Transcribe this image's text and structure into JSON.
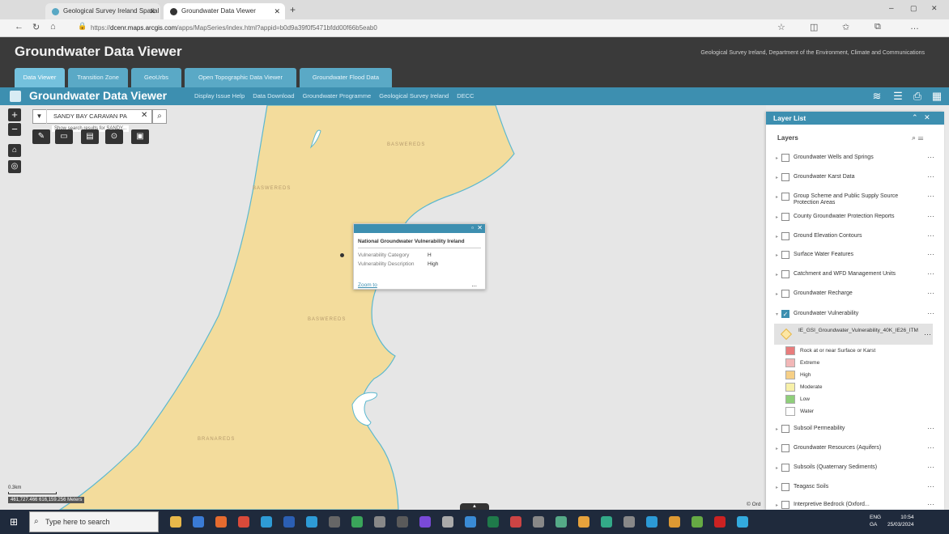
{
  "browser": {
    "tabs": [
      {
        "label": "Geological Survey Ireland Spatial",
        "active": false
      },
      {
        "label": "Groundwater Data Viewer",
        "active": true
      }
    ],
    "url_host": "dcenr.maps.arcgis.com",
    "url_path": "/apps/MapSeries/index.html?appid=b0d9a39f0f5471bfdd00f66b5eab0"
  },
  "app": {
    "title": "Groundwater Data Viewer",
    "department": "Geological Survey Ireland, Department of the Environment, Climate and Communications",
    "tabs": [
      "Data Viewer",
      "Transition Zone",
      "GeoUrbs",
      "Open Topographic Data Viewer",
      "Groundwater Flood Data"
    ]
  },
  "viewer": {
    "title": "Groundwater Data Viewer",
    "links": [
      "Display Issue Help",
      "Data Download",
      "Groundwater Programme",
      "Geological Survey Ireland",
      "DECC"
    ]
  },
  "map": {
    "search_value": "SANDY BAY CARAVAN PA",
    "search_hint": "Show search results for SANDY...",
    "labels": [
      "BASWEREDS",
      "BASWEREDS",
      "BASWEREDS",
      "BRANAREDS"
    ],
    "scale_label": "0.3km",
    "coordinates": "461,727.466 616,159.256 Meters",
    "attribution": "© Ord",
    "colors": {
      "vulnerability": "#f3dc9c",
      "water_line": "#5cb8cf"
    }
  },
  "popup": {
    "title": "National Groundwater Vulnerability Ireland",
    "rows": [
      {
        "label": "Vulnerability Category",
        "value": "H"
      },
      {
        "label": "Vulnerability Description",
        "value": "High"
      }
    ],
    "zoom_label": "Zoom to",
    "more": "..."
  },
  "layer_list": {
    "title": "Layer List",
    "subtitle": "Layers",
    "layers": [
      {
        "label": "Groundwater Wells and Springs",
        "checked": false
      },
      {
        "label": "Groundwater Karst Data",
        "checked": false
      },
      {
        "label": "Group Scheme and Public Supply Source Protection Areas",
        "checked": false
      },
      {
        "label": "County Groundwater Protection Reports",
        "checked": false
      },
      {
        "label": "Ground Elevation Contours",
        "checked": false
      },
      {
        "label": "Surface Water Features",
        "checked": false
      },
      {
        "label": "Catchment and WFD Management Units",
        "checked": false
      },
      {
        "label": "Groundwater Recharge",
        "checked": false
      },
      {
        "label": "Groundwater Vulnerability",
        "checked": true
      }
    ],
    "sublayer": "IE_GSI_Groundwater_Vulnerability_40K_IE26_ITM",
    "legend": [
      {
        "label": "Rock at or near Surface or Karst",
        "color": "#e87c7c"
      },
      {
        "label": "Extreme",
        "color": "#f2b7b7"
      },
      {
        "label": "High",
        "color": "#f6cf86"
      },
      {
        "label": "Moderate",
        "color": "#f7f0a8"
      },
      {
        "label": "Low",
        "color": "#8fcf7a"
      },
      {
        "label": "Water",
        "color": "#ffffff"
      }
    ],
    "layers_after": [
      {
        "label": "Subsoil Permeability",
        "checked": false
      },
      {
        "label": "Groundwater Resources (Aquifers)",
        "checked": false
      },
      {
        "label": "Subsoils (Quaternary Sediments)",
        "checked": false
      },
      {
        "label": "Teagasc Soils",
        "checked": false
      },
      {
        "label": "Interpretive Bedrock (Oxford...",
        "checked": false
      }
    ]
  },
  "taskbar": {
    "search_placeholder": "Type here to search",
    "language": "ENG",
    "language2": "GA",
    "time": "10:54",
    "date": "25/03/2024"
  }
}
